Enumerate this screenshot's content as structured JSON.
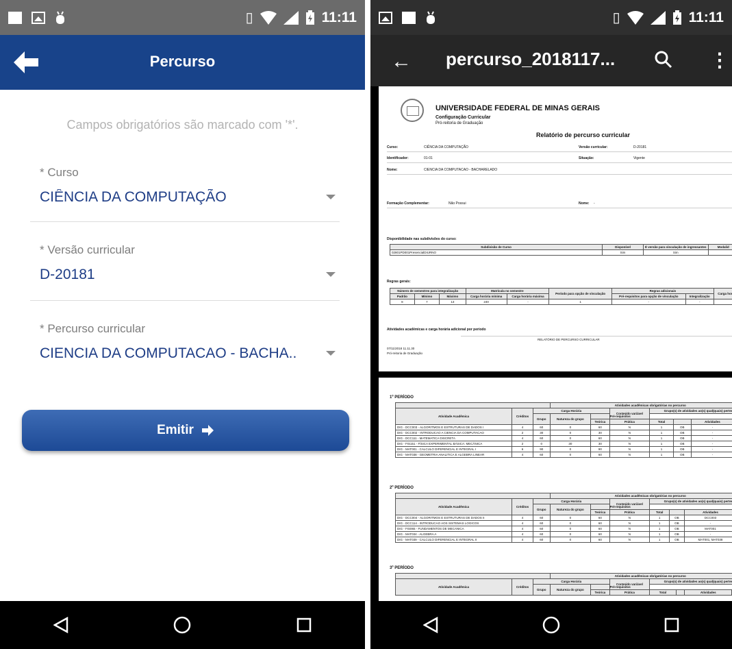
{
  "left_screen": {
    "status": {
      "time": "11:11"
    },
    "appbar": {
      "title": "Percurso"
    },
    "hint": "Campos obrigatórios são marcado com '*'.",
    "fields": [
      {
        "label": "* Curso",
        "value": "CIÊNCIA DA COMPUTAÇÃO"
      },
      {
        "label": "* Versão curricular",
        "value": "D-20181"
      },
      {
        "label": "* Percurso curricular",
        "value": "CIENCIA DA COMPUTACAO - BACHA.."
      }
    ],
    "emit_label": "Emitir"
  },
  "right_screen": {
    "status": {
      "time": "11:11"
    },
    "toolbar": {
      "filename": "percurso_2018117..."
    },
    "page1": {
      "university": "UNIVERSIDADE FEDERAL DE MINAS GERAIS",
      "subtitle": "Configuração Curricular",
      "office": "Pró-reitoria de Graduação",
      "report_title": "Relatório de percurso curricular",
      "curso_label": "Curso:",
      "curso_value": "CIÊNCIA DA COMPUTAÇÃO",
      "versao_label": "Versão curricular:",
      "versao_value": "D-20181",
      "ident_label": "Identificador:",
      "ident_value": "01-01",
      "situacao_label": "Situação:",
      "situacao_value": "Vigente",
      "nome_label": "Nome:",
      "nome_value": "CIENCIA DA COMPUTACAO - BACHARELADO",
      "formacao_label": "Formação Complementar:",
      "formacao_value": "Não Possui",
      "nome2_label": "Nome:",
      "nome2_value": "-",
      "disp_title": "Disponibilidade nas subdivisões do curso:",
      "disp_headers": [
        "Subdivisão de Curso",
        "Disponível",
        "É versão para vinculação de ingressantes",
        "Modalid"
      ],
      "disp_row": [
        "02801PD001PresencialDIURNO",
        "Sim",
        "Sim",
        ""
      ],
      "regras_title": "Regras gerais:",
      "regras_group_headers": [
        "Número de semestres para integralização",
        "Matrícula no semestre",
        "Período para opção de vinculação",
        "Regras adicionais",
        "Carga hor. integ"
      ],
      "regras_sub_headers": [
        "Padrão",
        "Mínimo",
        "Máximo",
        "Carga horária mínima",
        "Carga horária máxima",
        "Pré-requisitos para opção de vinculação",
        "Integralização"
      ],
      "regras_row": [
        "8",
        "7",
        "13",
        "240",
        "-",
        "1",
        "-",
        "-"
      ],
      "atividades_title": "Atividades acadêmicas e carga horária adicional por período",
      "footer_center": "RELATÓRIO DE PERCURSO CURRICULAR",
      "footer_date": "07/11/2018 11.11.30",
      "footer_office": "Pró-reitoria de Graduação"
    },
    "page2": {
      "table_caption": "Atividades acadêmicas obrigatórias no percurso",
      "headers": [
        "Atividade Acadêmica",
        "Créditos",
        "Carga Horária",
        "Conteúdo variável",
        "Grupo(s) de atividades ao(s) qual(quais) pertence",
        "Teórica",
        "Prática",
        "Total",
        "Grupo",
        "Natureza do grupo",
        "Pré-requisitos",
        "Atividades",
        "Ad"
      ],
      "periods": [
        {
          "title": "1º PERÍODO",
          "rows": [
            [
              "DIG - DCC003 - ALGORITMOS E ESTRUTURAS DE DADOS I",
              "4",
              "60",
              "0",
              "60",
              "N",
              "1",
              "OB",
              "-"
            ],
            [
              "DIG - DCC002 - INTRODUCAO A CIENCIA DA COMPUTACAO",
              "2",
              "30",
              "0",
              "30",
              "N",
              "1",
              "OB",
              "-"
            ],
            [
              "DIG - DCC111 - MATEMATICA DISCRETA",
              "4",
              "60",
              "0",
              "60",
              "N",
              "1",
              "OB",
              "-"
            ],
            [
              "DIG - FIS151 - FÍSICA EXPERIMENTAL BÁSICA: MECÂNICA",
              "2",
              "0",
              "30",
              "30",
              "N",
              "1",
              "OB",
              "-"
            ],
            [
              "DIG - MAT001 - CALCULO DIFERENCIAL E INTEGRAL I",
              "6",
              "90",
              "0",
              "90",
              "N",
              "1",
              "OB",
              "-"
            ],
            [
              "DIG - MAT038 - GEOMETRIA ANALITICA E ALGEBRA LINEAR",
              "4",
              "60",
              "0",
              "60",
              "N",
              "1",
              "OB",
              "-"
            ]
          ]
        },
        {
          "title": "2º PERÍODO",
          "rows": [
            [
              "DIG - DCC004 - ALGORITMOS E ESTRUTURAS DE DADOS II",
              "4",
              "60",
              "0",
              "60",
              "N",
              "1",
              "OB",
              "DCC003"
            ],
            [
              "DIG - DCC114 - INTRODUCAO AOS SISTEMAS LOGICOS",
              "4",
              "60",
              "0",
              "60",
              "N",
              "1",
              "OB",
              "-"
            ],
            [
              "DIG - FIS065 - FUNDAMENTOS DE MECANICA",
              "4",
              "60",
              "0",
              "60",
              "N",
              "1",
              "OB",
              "MAT001"
            ],
            [
              "DIG - MAT034 - ALGEBRA A",
              "4",
              "60",
              "0",
              "60",
              "N",
              "1",
              "OB",
              "-"
            ],
            [
              "DIG - MAT039 - CALCULO DIFERENCIAL E INTEGRAL II",
              "4",
              "60",
              "0",
              "60",
              "N",
              "1",
              "OB",
              "MAT001, MAT038"
            ]
          ]
        },
        {
          "title": "3º PERÍODO",
          "rows": []
        }
      ]
    }
  },
  "colors": {
    "appbar": "#18438a",
    "field_value": "#1e3d86",
    "button": "#2a5aa6"
  }
}
